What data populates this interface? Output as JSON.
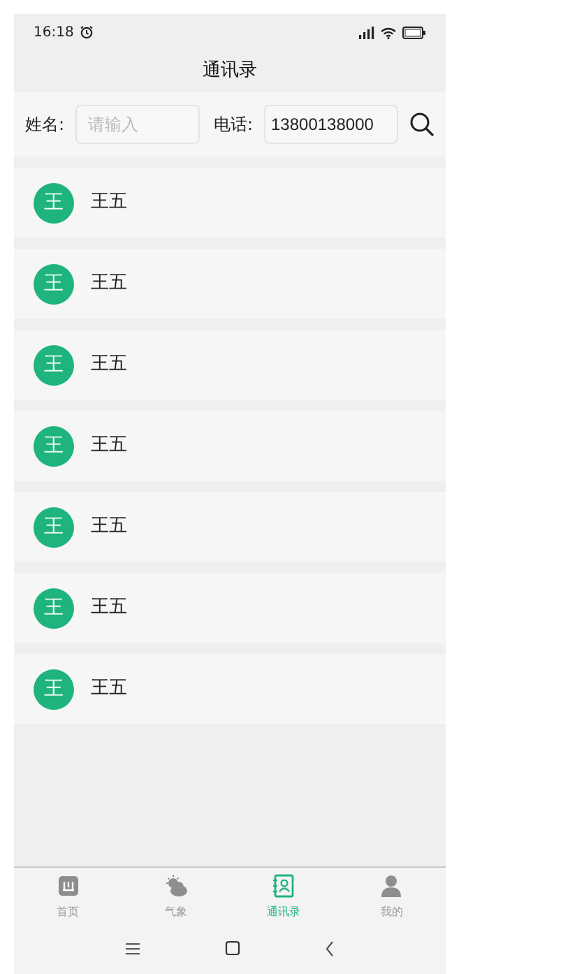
{
  "status_bar": {
    "time": "16:18"
  },
  "title": "通讯录",
  "search": {
    "name_label": "姓名:",
    "name_placeholder": "请输入",
    "phone_label": "电话:",
    "phone_value": "13800138000"
  },
  "contacts": [
    {
      "avatar": "王",
      "name": "王五"
    },
    {
      "avatar": "王",
      "name": "王五"
    },
    {
      "avatar": "王",
      "name": "王五"
    },
    {
      "avatar": "王",
      "name": "王五"
    },
    {
      "avatar": "王",
      "name": "王五"
    },
    {
      "avatar": "王",
      "name": "王五"
    },
    {
      "avatar": "王",
      "name": "王五"
    }
  ],
  "tab_bar": [
    {
      "kind": "home",
      "label": "首页",
      "selected": false
    },
    {
      "kind": "weather",
      "label": "气象",
      "selected": false
    },
    {
      "kind": "contacts",
      "label": "通讯录",
      "selected": true
    },
    {
      "kind": "profile",
      "label": "我的",
      "selected": false
    }
  ]
}
